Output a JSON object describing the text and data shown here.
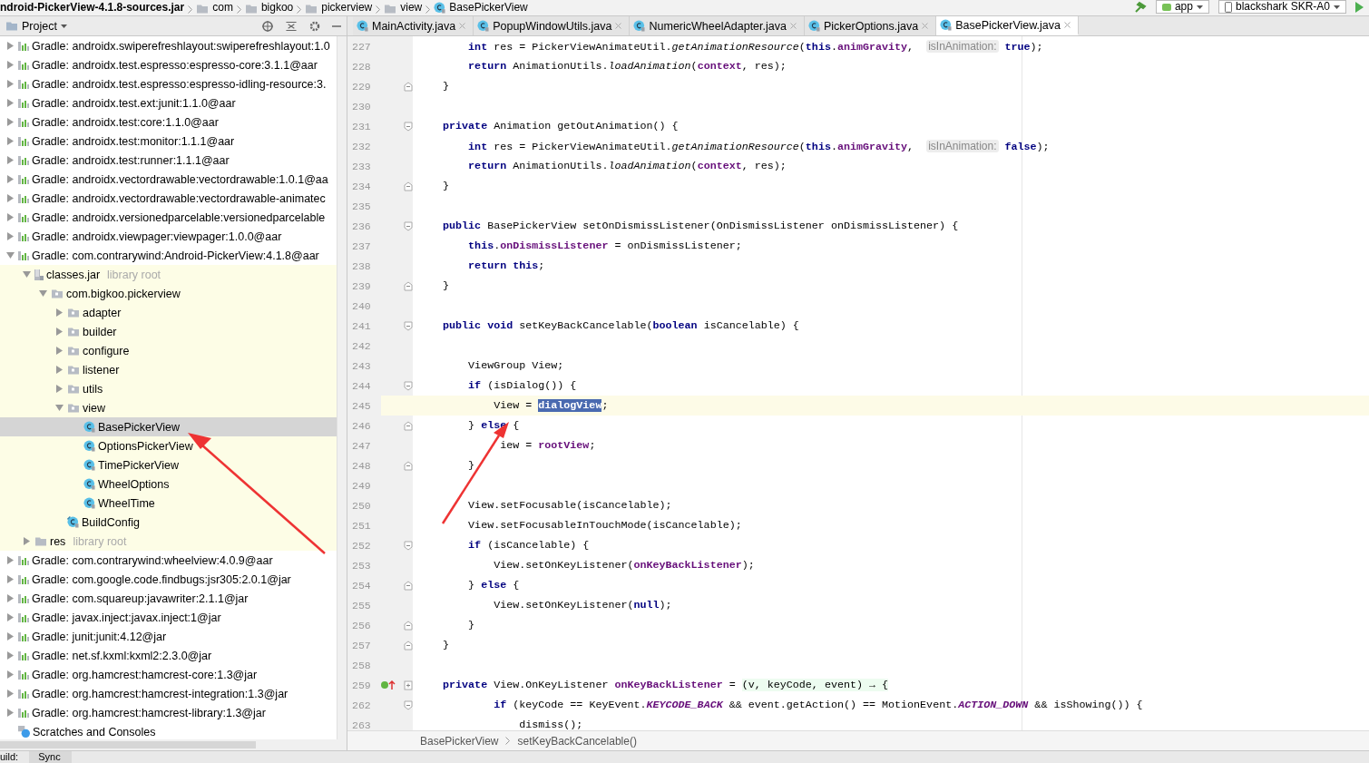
{
  "nav_bar": {
    "crumbs": [
      {
        "kind": "jar",
        "label": "ndroid-PickerView-4.1.8-sources.jar"
      },
      {
        "kind": "folder",
        "label": "com"
      },
      {
        "kind": "folder",
        "label": "bigkoo"
      },
      {
        "kind": "folder",
        "label": "pickerview"
      },
      {
        "kind": "folder",
        "label": "view"
      },
      {
        "kind": "class",
        "label": "BasePickerView"
      }
    ],
    "run_config": "app",
    "device": "blackshark SKR-A0"
  },
  "project_panel": {
    "title": "Project",
    "tree": [
      {
        "kind": "library",
        "label": "Gradle: androidx.swiperefreshlayout:swiperefreshlayout:1.0",
        "expanded": false
      },
      {
        "kind": "library",
        "label": "Gradle: androidx.test.espresso:espresso-core:3.1.1@aar",
        "expanded": false
      },
      {
        "kind": "library",
        "label": "Gradle: androidx.test.espresso:espresso-idling-resource:3.",
        "expanded": false
      },
      {
        "kind": "library",
        "label": "Gradle: androidx.test.ext:junit:1.1.0@aar",
        "expanded": false
      },
      {
        "kind": "library",
        "label": "Gradle: androidx.test:core:1.1.0@aar",
        "expanded": false
      },
      {
        "kind": "library",
        "label": "Gradle: androidx.test:monitor:1.1.1@aar",
        "expanded": false
      },
      {
        "kind": "library",
        "label": "Gradle: androidx.test:runner:1.1.1@aar",
        "expanded": false
      },
      {
        "kind": "library",
        "label": "Gradle: androidx.vectordrawable:vectordrawable:1.0.1@aa",
        "expanded": false
      },
      {
        "kind": "library",
        "label": "Gradle: androidx.vectordrawable:vectordrawable-animatec",
        "expanded": false
      },
      {
        "kind": "library",
        "label": "Gradle: androidx.versionedparcelable:versionedparcelable",
        "expanded": false
      },
      {
        "kind": "library",
        "label": "Gradle: androidx.viewpager:viewpager:1.0.0@aar",
        "expanded": false
      },
      {
        "kind": "library",
        "label": "Gradle: com.contrarywind:Android-PickerView:4.1.8@aar",
        "expanded": true,
        "children": [
          {
            "kind": "jar",
            "label": "classes.jar",
            "hint": "library root",
            "expanded": true,
            "children": [
              {
                "kind": "package",
                "label": "com.bigkoo.pickerview",
                "expanded": true,
                "children": [
                  {
                    "kind": "package",
                    "label": "adapter",
                    "expanded": false
                  },
                  {
                    "kind": "package",
                    "label": "builder",
                    "expanded": false
                  },
                  {
                    "kind": "package",
                    "label": "configure",
                    "expanded": false
                  },
                  {
                    "kind": "package",
                    "label": "listener",
                    "expanded": false
                  },
                  {
                    "kind": "package",
                    "label": "utils",
                    "expanded": false
                  },
                  {
                    "kind": "package",
                    "label": "view",
                    "expanded": true,
                    "children": [
                      {
                        "kind": "class",
                        "label": "BasePickerView",
                        "selected": true
                      },
                      {
                        "kind": "class",
                        "label": "OptionsPickerView",
                        "selected": false
                      },
                      {
                        "kind": "class",
                        "label": "TimePickerView",
                        "selected": false
                      },
                      {
                        "kind": "class",
                        "label": "WheelOptions",
                        "selected": false
                      },
                      {
                        "kind": "class",
                        "label": "WheelTime",
                        "selected": false
                      }
                    ]
                  },
                  {
                    "kind": "config",
                    "label": "BuildConfig",
                    "selected": false
                  }
                ]
              }
            ]
          },
          {
            "kind": "folder",
            "label": "res",
            "hint": "library root",
            "expanded": false
          }
        ]
      },
      {
        "kind": "library",
        "label": "Gradle: com.contrarywind:wheelview:4.0.9@aar",
        "expanded": false
      },
      {
        "kind": "library",
        "label": "Gradle: com.google.code.findbugs:jsr305:2.0.1@jar",
        "expanded": false
      },
      {
        "kind": "library",
        "label": "Gradle: com.squareup:javawriter:2.1.1@jar",
        "expanded": false
      },
      {
        "kind": "library",
        "label": "Gradle: javax.inject:javax.inject:1@jar",
        "expanded": false
      },
      {
        "kind": "library",
        "label": "Gradle: junit:junit:4.12@jar",
        "expanded": false
      },
      {
        "kind": "library",
        "label": "Gradle: net.sf.kxml:kxml2:2.3.0@jar",
        "expanded": false
      },
      {
        "kind": "library",
        "label": "Gradle: org.hamcrest:hamcrest-core:1.3@jar",
        "expanded": false
      },
      {
        "kind": "library",
        "label": "Gradle: org.hamcrest:hamcrest-integration:1.3@jar",
        "expanded": false
      },
      {
        "kind": "library",
        "label": "Gradle: org.hamcrest:hamcrest-library:1.3@jar",
        "expanded": false
      },
      {
        "kind": "scratches",
        "label": "Scratches and Consoles"
      }
    ]
  },
  "editor_tabs": [
    {
      "label": "MainActivity.java",
      "selected": false
    },
    {
      "label": "PopupWindowUtils.java",
      "selected": false
    },
    {
      "label": "NumericWheelAdapter.java",
      "selected": false
    },
    {
      "label": "PickerOptions.java",
      "selected": false
    },
    {
      "label": "BasePickerView.java",
      "selected": true
    }
  ],
  "code": [
    {
      "number": "227",
      "current": false,
      "segments": [
        {
          "kind": "kw",
          "text": "        int"
        },
        {
          "kind": "plain",
          "text": " res = PickerViewAnimateUtil."
        },
        {
          "kind": "static",
          "text": "getAnimationResource"
        },
        {
          "kind": "plain",
          "text": "("
        },
        {
          "kind": "kw",
          "text": "this"
        },
        {
          "kind": "plain",
          "text": "."
        },
        {
          "kind": "field",
          "text": "animGravity"
        },
        {
          "kind": "plain",
          "text": ",  "
        },
        {
          "kind": "hint",
          "text": "isInAnimation:"
        },
        {
          "kind": "kw",
          "text": " true"
        },
        {
          "kind": "plain",
          "text": ");"
        }
      ]
    },
    {
      "number": "228",
      "current": false,
      "segments": [
        {
          "kind": "kw",
          "text": "        return"
        },
        {
          "kind": "plain",
          "text": " AnimationUtils."
        },
        {
          "kind": "static",
          "text": "loadAnimation"
        },
        {
          "kind": "plain",
          "text": "("
        },
        {
          "kind": "field",
          "text": "context"
        },
        {
          "kind": "plain",
          "text": ", res);"
        }
      ]
    },
    {
      "number": "229",
      "current": false,
      "fold_end": true,
      "segments": [
        {
          "kind": "plain",
          "text": "    }"
        }
      ]
    },
    {
      "number": "230",
      "current": false
    },
    {
      "number": "231",
      "current": false,
      "fold_start": true,
      "segments": [
        {
          "kind": "kw",
          "text": "    private"
        },
        {
          "kind": "plain",
          "text": " Animation getOutAnimation() {"
        }
      ]
    },
    {
      "number": "232",
      "current": false,
      "segments": [
        {
          "kind": "kw",
          "text": "        int"
        },
        {
          "kind": "plain",
          "text": " res = PickerViewAnimateUtil."
        },
        {
          "kind": "static",
          "text": "getAnimationResource"
        },
        {
          "kind": "plain",
          "text": "("
        },
        {
          "kind": "kw",
          "text": "this"
        },
        {
          "kind": "plain",
          "text": "."
        },
        {
          "kind": "field",
          "text": "animGravity"
        },
        {
          "kind": "plain",
          "text": ",  "
        },
        {
          "kind": "hint",
          "text": "isInAnimation:"
        },
        {
          "kind": "kw",
          "text": " false"
        },
        {
          "kind": "plain",
          "text": ");"
        }
      ]
    },
    {
      "number": "233",
      "current": false,
      "segments": [
        {
          "kind": "kw",
          "text": "        return"
        },
        {
          "kind": "plain",
          "text": " AnimationUtils."
        },
        {
          "kind": "static",
          "text": "loadAnimation"
        },
        {
          "kind": "plain",
          "text": "("
        },
        {
          "kind": "field",
          "text": "context"
        },
        {
          "kind": "plain",
          "text": ", res);"
        }
      ]
    },
    {
      "number": "234",
      "current": false,
      "fold_end": true,
      "segments": [
        {
          "kind": "plain",
          "text": "    }"
        }
      ]
    },
    {
      "number": "235",
      "current": false
    },
    {
      "number": "236",
      "current": false,
      "fold_start": true,
      "segments": [
        {
          "kind": "kw",
          "text": "    public"
        },
        {
          "kind": "plain",
          "text": " BasePickerView setOnDismissListener(OnDismissListener onDismissListener) {"
        }
      ]
    },
    {
      "number": "237",
      "current": false,
      "segments": [
        {
          "kind": "kw",
          "text": "        this"
        },
        {
          "kind": "plain",
          "text": "."
        },
        {
          "kind": "field",
          "text": "onDismissListener"
        },
        {
          "kind": "plain",
          "text": " = onDismissListener;"
        }
      ]
    },
    {
      "number": "238",
      "current": false,
      "segments": [
        {
          "kind": "kw",
          "text": "        return this"
        },
        {
          "kind": "plain",
          "text": ";"
        }
      ]
    },
    {
      "number": "239",
      "current": false,
      "fold_end": true,
      "segments": [
        {
          "kind": "plain",
          "text": "    }"
        }
      ]
    },
    {
      "number": "240",
      "current": false
    },
    {
      "number": "241",
      "current": false,
      "fold_start": true,
      "segments": [
        {
          "kind": "kw",
          "text": "    public void"
        },
        {
          "kind": "plain",
          "text": " setKeyBackCancelable("
        },
        {
          "kind": "kw",
          "text": "boolean"
        },
        {
          "kind": "plain",
          "text": " isCancelable) {"
        }
      ]
    },
    {
      "number": "242",
      "current": false
    },
    {
      "number": "243",
      "current": false,
      "segments": [
        {
          "kind": "plain",
          "text": "        ViewGroup View;"
        }
      ]
    },
    {
      "number": "244",
      "current": false,
      "fold_start": true,
      "segments": [
        {
          "kind": "kw",
          "text": "        if"
        },
        {
          "kind": "plain",
          "text": " (isDialog()) {"
        }
      ]
    },
    {
      "number": "245",
      "current": true,
      "segments": [
        {
          "kind": "plain",
          "text": "            View = "
        },
        {
          "kind": "selected",
          "text": "dialogView"
        },
        {
          "kind": "plain",
          "text": ";"
        }
      ]
    },
    {
      "number": "246",
      "current": false,
      "fold_end": true,
      "segments": [
        {
          "kind": "plain",
          "text": "        } "
        },
        {
          "kind": "kw",
          "text": "else"
        },
        {
          "kind": "plain",
          "text": " {"
        }
      ]
    },
    {
      "number": "247",
      "current": false,
      "segments": [
        {
          "kind": "plain",
          "text": "             iew = "
        },
        {
          "kind": "field",
          "text": "rootView"
        },
        {
          "kind": "plain",
          "text": ";"
        }
      ]
    },
    {
      "number": "248",
      "current": false,
      "fold_end": true,
      "segments": [
        {
          "kind": "plain",
          "text": "        }"
        }
      ]
    },
    {
      "number": "249",
      "current": false
    },
    {
      "number": "250",
      "current": false,
      "segments": [
        {
          "kind": "plain",
          "text": "        View.setFocusable(isCancelable);"
        }
      ]
    },
    {
      "number": "251",
      "current": false,
      "segments": [
        {
          "kind": "plain",
          "text": "        View.setFocusableInTouchMode(isCancelable);"
        }
      ]
    },
    {
      "number": "252",
      "current": false,
      "fold_start": true,
      "segments": [
        {
          "kind": "kw",
          "text": "        if"
        },
        {
          "kind": "plain",
          "text": " (isCancelable) {"
        }
      ]
    },
    {
      "number": "253",
      "current": false,
      "segments": [
        {
          "kind": "plain",
          "text": "            View.setOnKeyListener("
        },
        {
          "kind": "field",
          "text": "onKeyBackListener"
        },
        {
          "kind": "plain",
          "text": ");"
        }
      ]
    },
    {
      "number": "254",
      "current": false,
      "fold_end": true,
      "segments": [
        {
          "kind": "plain",
          "text": "        } "
        },
        {
          "kind": "kw",
          "text": "else"
        },
        {
          "kind": "plain",
          "text": " {"
        }
      ]
    },
    {
      "number": "255",
      "current": false,
      "segments": [
        {
          "kind": "plain",
          "text": "            View.setOnKeyListener("
        },
        {
          "kind": "kw",
          "text": "null"
        },
        {
          "kind": "plain",
          "text": ");"
        }
      ]
    },
    {
      "number": "256",
      "current": false,
      "fold_end": true,
      "segments": [
        {
          "kind": "plain",
          "text": "        }"
        }
      ]
    },
    {
      "number": "257",
      "current": false,
      "fold_end": true,
      "segments": [
        {
          "kind": "plain",
          "text": "    }"
        }
      ]
    },
    {
      "number": "258",
      "current": false
    },
    {
      "number": "259",
      "current": false,
      "folded": true,
      "implements": true,
      "segments": [
        {
          "kind": "kw",
          "text": "    private"
        },
        {
          "kind": "plain",
          "text": " View.OnKeyListener "
        },
        {
          "kind": "field",
          "text": "onKeyBackListener"
        },
        {
          "kind": "plain",
          "text": " = "
        },
        {
          "kind": "lambda",
          "text": "(v, keyCode, event) → {"
        }
      ]
    },
    {
      "number": "262",
      "current": false,
      "fold_start": true,
      "segments": [
        {
          "kind": "kw",
          "text": "            if"
        },
        {
          "kind": "plain",
          "text": " (keyCode == KeyEvent."
        },
        {
          "kind": "const",
          "text": "KEYCODE_BACK"
        },
        {
          "kind": "plain",
          "text": " && event.getAction() == MotionEvent."
        },
        {
          "kind": "const",
          "text": "ACTION_DOWN"
        },
        {
          "kind": "plain",
          "text": " && isShowing()) {"
        }
      ]
    },
    {
      "number": "263",
      "current": false,
      "segments": [
        {
          "kind": "plain",
          "text": "                dismiss();"
        }
      ]
    }
  ],
  "breadcrumb": [
    "BasePickerView",
    "setKeyBackCancelable()"
  ],
  "bottom_tabs": [
    {
      "label": "uild:",
      "selected": false
    },
    {
      "label": "Sync",
      "selected": true
    }
  ]
}
